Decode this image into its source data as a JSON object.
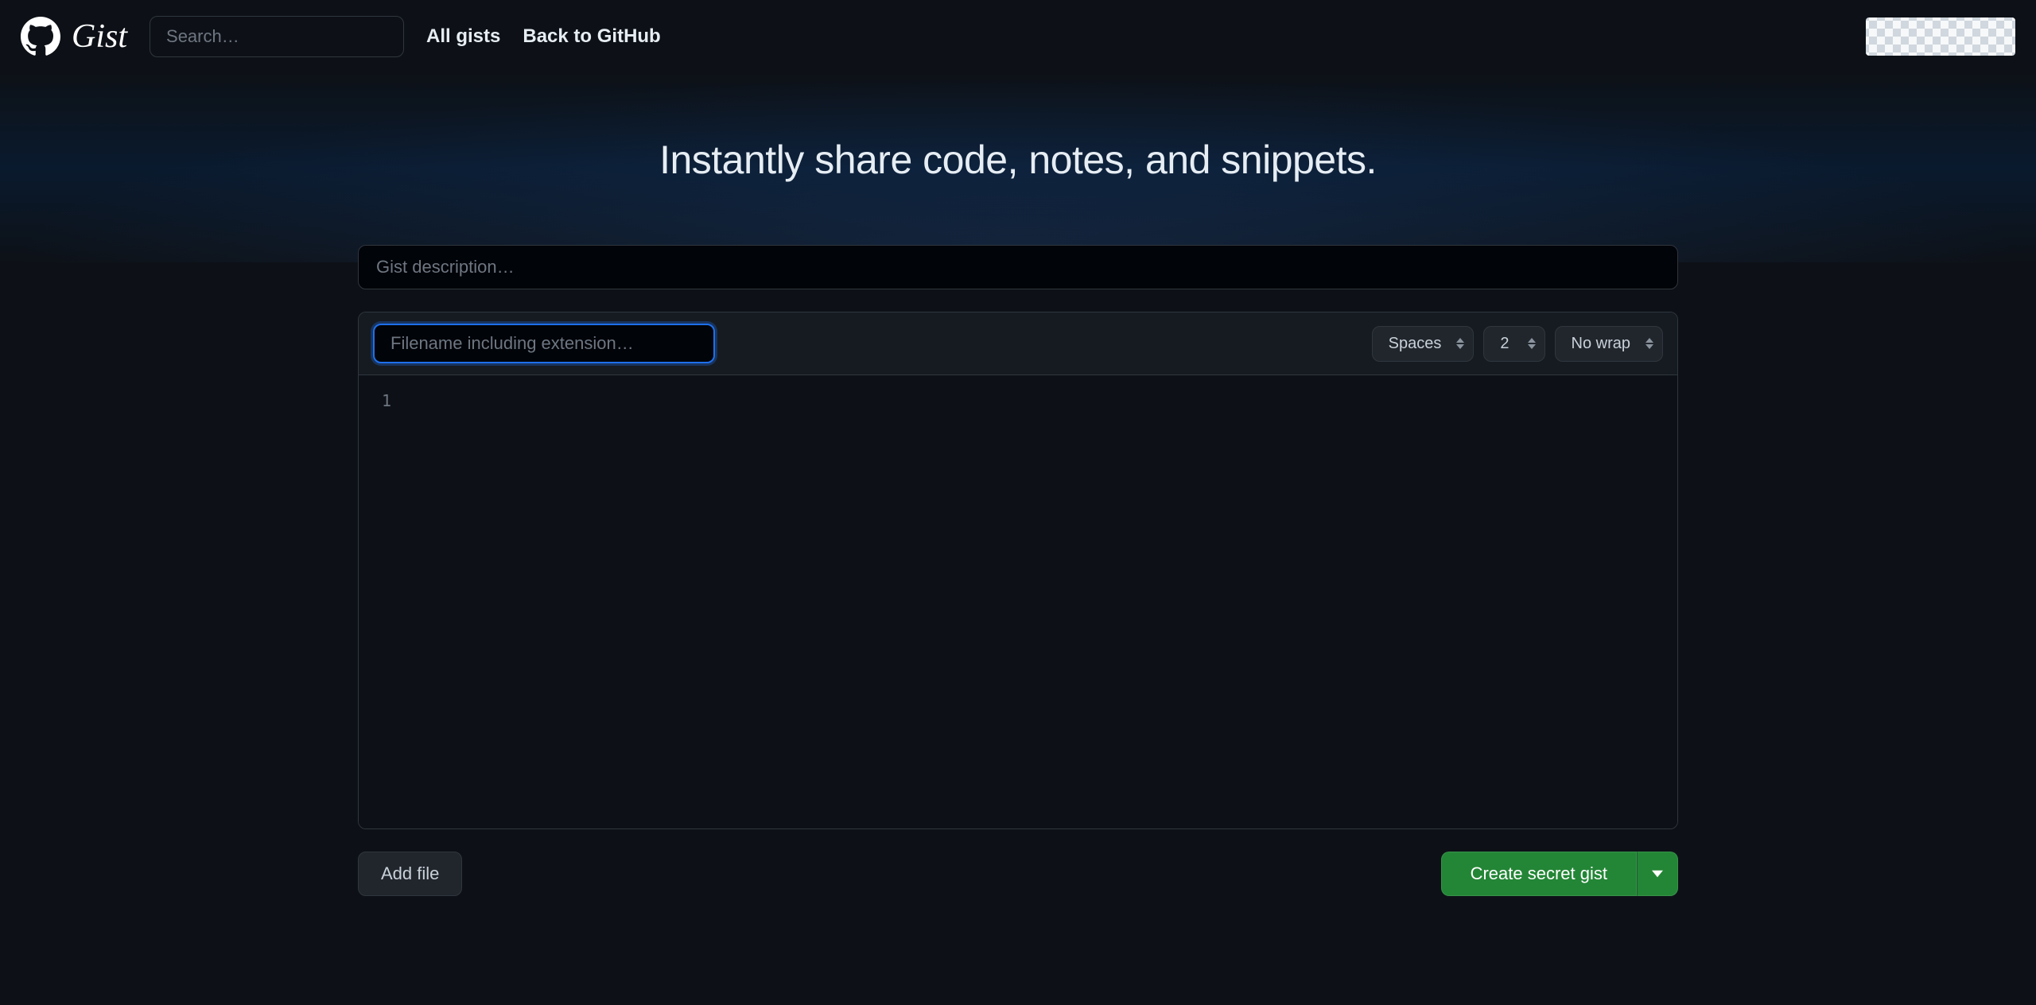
{
  "header": {
    "logo_text": "GitHub Gist",
    "search_placeholder": "Search…",
    "nav": {
      "all_gists": "All gists",
      "back_to_github": "Back to GitHub"
    }
  },
  "hero": {
    "title": "Instantly share code, notes, and snippets."
  },
  "form": {
    "description_placeholder": "Gist description…",
    "filename_placeholder": "Filename including extension…",
    "indent_mode": "Spaces",
    "indent_size": "2",
    "wrap_mode": "No wrap"
  },
  "editor": {
    "line_numbers": [
      "1"
    ]
  },
  "actions": {
    "add_file": "Add file",
    "create_secret": "Create secret gist"
  }
}
